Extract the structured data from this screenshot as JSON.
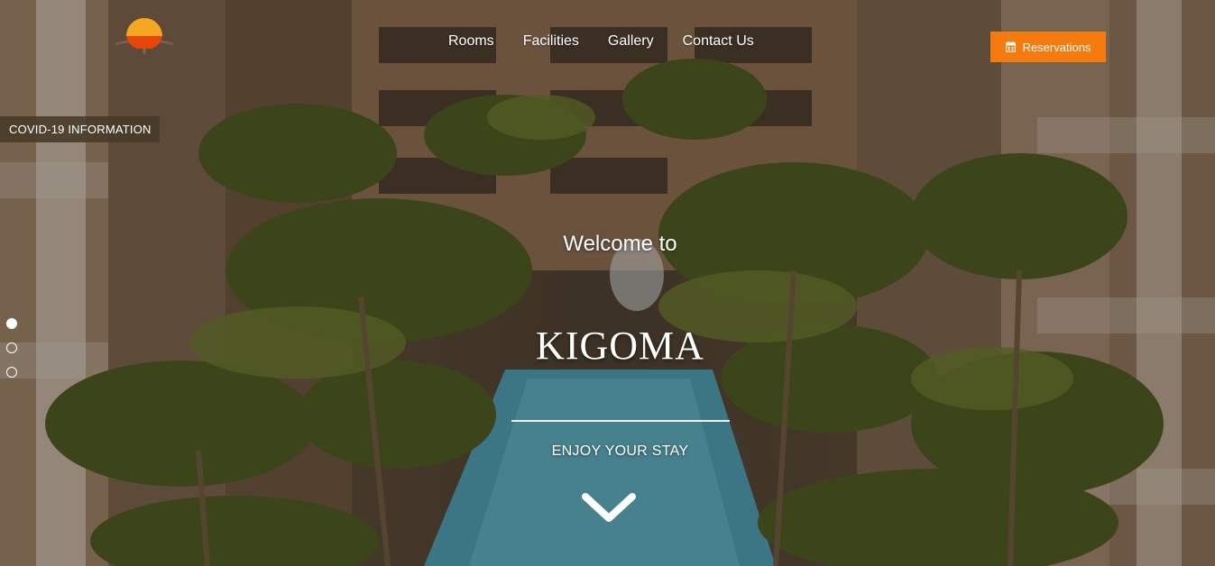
{
  "nav": {
    "items": [
      {
        "label": "Rooms"
      },
      {
        "label": "Facilities"
      },
      {
        "label": "Gallery"
      },
      {
        "label": "Contact Us"
      }
    ]
  },
  "reservations": {
    "label": "Reservations",
    "icon": "calendar-icon",
    "color": "#f57b0f"
  },
  "covid": {
    "label": "COVID-19 INFORMATION"
  },
  "hero": {
    "welcome": "Welcome to",
    "brand": "KIGOMA",
    "tagline": "ENJOY YOUR STAY",
    "scroll_icon": "chevron-down-icon"
  },
  "slider": {
    "count": 3,
    "active": 1
  },
  "logo": {
    "icon": "sun-logo-icon",
    "colors": [
      "#f5a623",
      "#e8470c"
    ]
  }
}
